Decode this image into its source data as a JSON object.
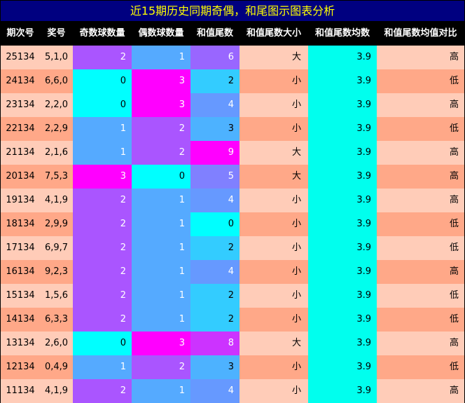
{
  "title": "近15期历史同期奇偶，和尾图示图表分析",
  "headers": [
    "期次号",
    "奖号",
    "奇数球数量",
    "偶数球数量",
    "和值尾数",
    "和值尾数大小",
    "和值尾数均数",
    "和值尾数均值对比"
  ],
  "colors": {
    "title_bg": "#000080",
    "title_text": "#ffff00",
    "header_bg": "#000000",
    "header_text": "#ffffff",
    "row_light": "#ffccb8",
    "row_dark": "#ffa888",
    "avg_bg": "#00ffee"
  },
  "chart_data": {
    "type": "table",
    "columns": [
      "期次号",
      "奖号",
      "奇数球数量",
      "偶数球数量",
      "和值尾数",
      "和值尾数大小",
      "和值尾数均数",
      "和值尾数均值对比"
    ],
    "rows": [
      {
        "issue": "25134",
        "numbers": "5,1,0",
        "odd": 2,
        "even": 1,
        "tail": 6,
        "size": "大",
        "avg": "3.9",
        "compare": "高"
      },
      {
        "issue": "24134",
        "numbers": "6,6,0",
        "odd": 0,
        "even": 3,
        "tail": 2,
        "size": "小",
        "avg": "3.9",
        "compare": "低"
      },
      {
        "issue": "23134",
        "numbers": "2,2,0",
        "odd": 0,
        "even": 3,
        "tail": 4,
        "size": "小",
        "avg": "3.9",
        "compare": "高"
      },
      {
        "issue": "22134",
        "numbers": "2,2,9",
        "odd": 1,
        "even": 2,
        "tail": 3,
        "size": "小",
        "avg": "3.9",
        "compare": "低"
      },
      {
        "issue": "21134",
        "numbers": "2,1,6",
        "odd": 1,
        "even": 2,
        "tail": 9,
        "size": "大",
        "avg": "3.9",
        "compare": "高"
      },
      {
        "issue": "20134",
        "numbers": "7,5,3",
        "odd": 3,
        "even": 0,
        "tail": 5,
        "size": "大",
        "avg": "3.9",
        "compare": "高"
      },
      {
        "issue": "19134",
        "numbers": "4,1,9",
        "odd": 2,
        "even": 1,
        "tail": 4,
        "size": "小",
        "avg": "3.9",
        "compare": "高"
      },
      {
        "issue": "18134",
        "numbers": "2,9,9",
        "odd": 2,
        "even": 1,
        "tail": 0,
        "size": "小",
        "avg": "3.9",
        "compare": "低"
      },
      {
        "issue": "17134",
        "numbers": "6,9,7",
        "odd": 2,
        "even": 1,
        "tail": 2,
        "size": "小",
        "avg": "3.9",
        "compare": "低"
      },
      {
        "issue": "16134",
        "numbers": "9,2,3",
        "odd": 2,
        "even": 1,
        "tail": 4,
        "size": "小",
        "avg": "3.9",
        "compare": "高"
      },
      {
        "issue": "15134",
        "numbers": "1,5,6",
        "odd": 2,
        "even": 1,
        "tail": 2,
        "size": "小",
        "avg": "3.9",
        "compare": "低"
      },
      {
        "issue": "14134",
        "numbers": "6,3,3",
        "odd": 2,
        "even": 1,
        "tail": 2,
        "size": "小",
        "avg": "3.9",
        "compare": "低"
      },
      {
        "issue": "13134",
        "numbers": "2,6,0",
        "odd": 0,
        "even": 3,
        "tail": 8,
        "size": "大",
        "avg": "3.9",
        "compare": "高"
      },
      {
        "issue": "12134",
        "numbers": "0,4,9",
        "odd": 1,
        "even": 2,
        "tail": 3,
        "size": "小",
        "avg": "3.9",
        "compare": "低"
      },
      {
        "issue": "11134",
        "numbers": "4,1,9",
        "odd": 2,
        "even": 1,
        "tail": 4,
        "size": "小",
        "avg": "3.9",
        "compare": "高"
      }
    ],
    "count_colors": {
      "0": "#00ffff",
      "1": "#55aaff",
      "2": "#aa55ff",
      "3": "#ff00ff"
    },
    "tail_colors": {
      "0": "#00ffff",
      "1": "#1ae5ff",
      "2": "#33ccff",
      "3": "#4db2ff",
      "4": "#6699ff",
      "5": "#8080ff",
      "6": "#9966ff",
      "7": "#b34dff",
      "8": "#cc33ff",
      "9": "#ff00ff"
    }
  }
}
